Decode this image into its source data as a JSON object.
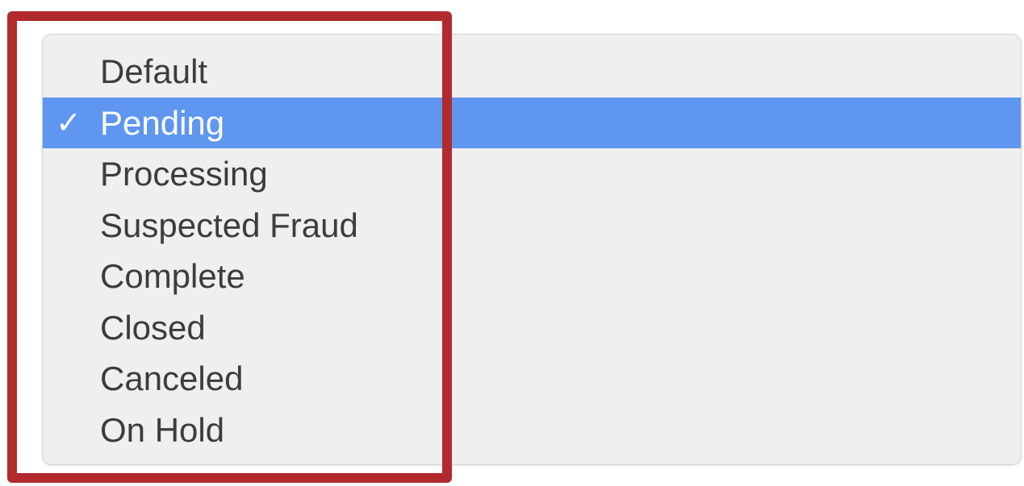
{
  "dropdown": {
    "selected_index": 1,
    "check_glyph": "✓",
    "items": [
      {
        "label": "Default"
      },
      {
        "label": "Pending"
      },
      {
        "label": "Processing"
      },
      {
        "label": "Suspected Fraud"
      },
      {
        "label": "Complete"
      },
      {
        "label": "Closed"
      },
      {
        "label": "Canceled"
      },
      {
        "label": "On Hold"
      }
    ]
  },
  "colors": {
    "menu_background": "#efefef",
    "selection_highlight": "#5e96f0",
    "annotation_frame": "#b02a2e",
    "text": "#3c3c3c"
  }
}
